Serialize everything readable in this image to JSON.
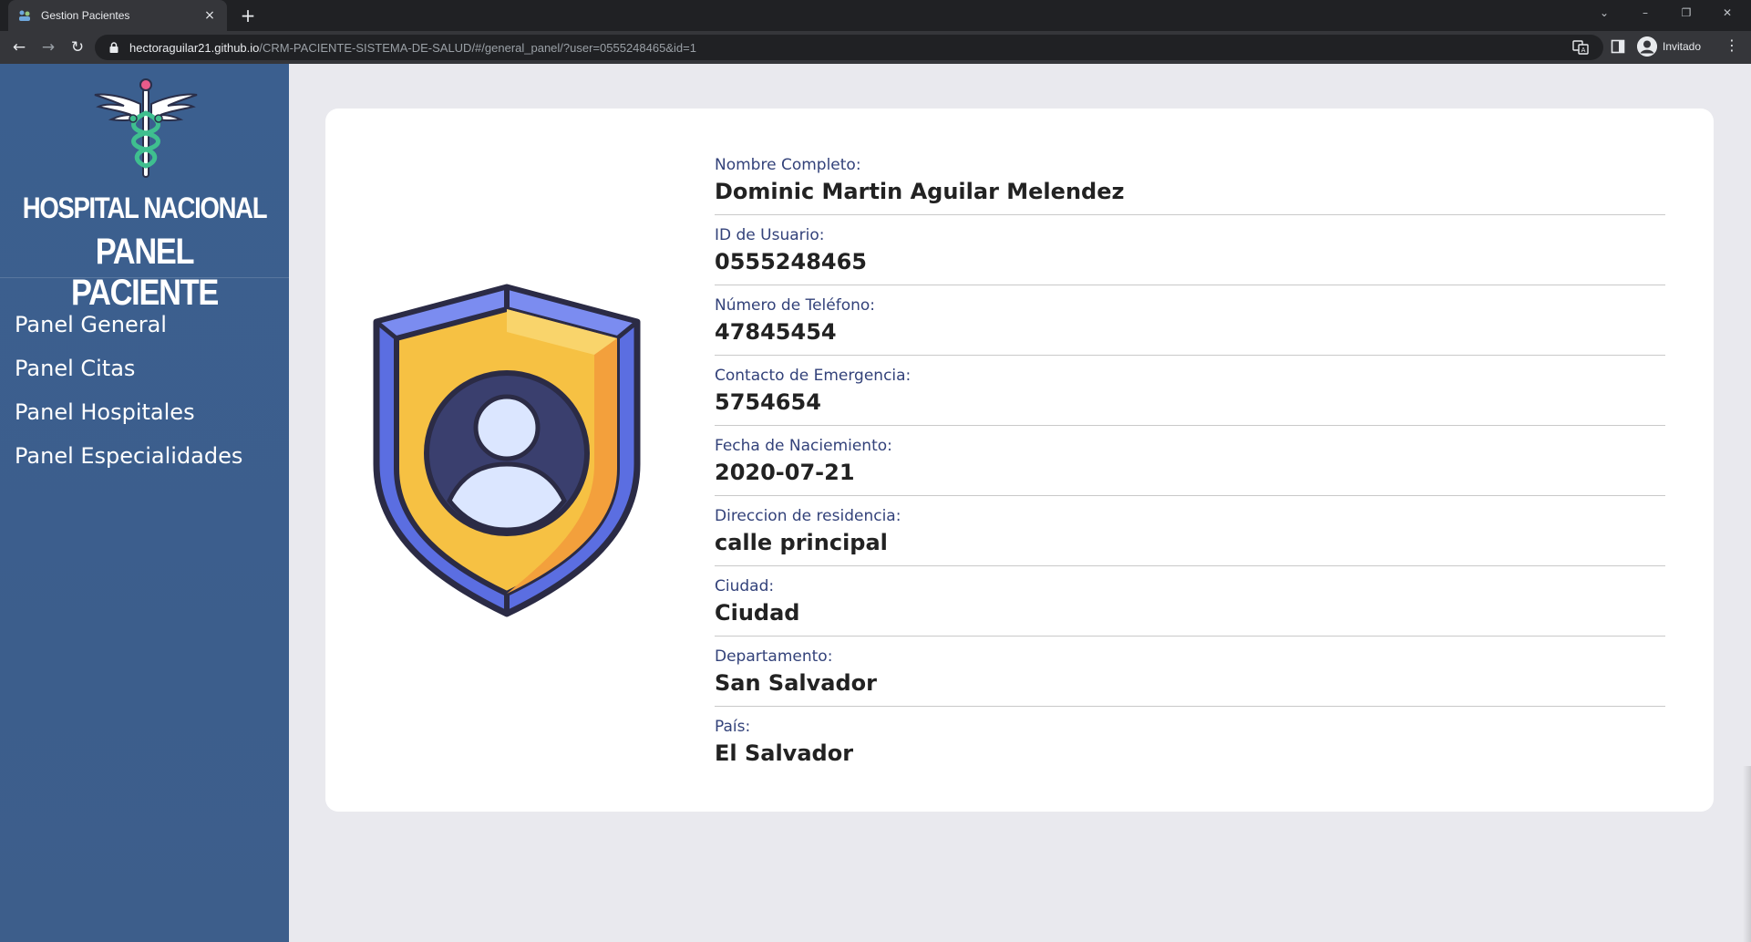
{
  "browser": {
    "tab_title": "Gestion Pacientes",
    "tab_close": "×",
    "new_tab": "+",
    "url_host": "hectoraguilar21.github.io",
    "url_path": "/CRM-PACIENTE-SISTEMA-DE-SALUD/#/general_panel/?user=0555248465&id=1",
    "profile_label": "Invitado",
    "icons": [
      "back-icon",
      "forward-icon",
      "reload-icon",
      "lock-icon",
      "translate-icon",
      "side-panel-icon",
      "profile-icon",
      "menu-icon"
    ]
  },
  "sidebar": {
    "brand_line1": "HOSPITAL NACIONAL",
    "brand_line2": "PANEL PACIENTE",
    "items": [
      {
        "label": "Panel General"
      },
      {
        "label": "Panel Citas"
      },
      {
        "label": "Panel Hospitales"
      },
      {
        "label": "Panel Especialidades"
      }
    ]
  },
  "patient": {
    "fields": [
      {
        "label": "Nombre Completo:",
        "value": "Dominic Martin Aguilar Melendez"
      },
      {
        "label": "ID de Usuario:",
        "value": "0555248465"
      },
      {
        "label": "Número de Teléfono:",
        "value": "47845454"
      },
      {
        "label": "Contacto de Emergencia:",
        "value": "5754654"
      },
      {
        "label": "Fecha de Naciemiento:",
        "value": "2020-07-21"
      },
      {
        "label": "Direccion de residencia:",
        "value": "calle principal"
      },
      {
        "label": "Ciudad:",
        "value": "Ciudad"
      },
      {
        "label": "Departamento:",
        "value": "San Salvador"
      },
      {
        "label": "País:",
        "value": "El Salvador"
      }
    ]
  },
  "colors": {
    "sidebar": "#3b5f8f",
    "label": "#33427a",
    "shield_outer": "#5b6ee1",
    "shield_inner": "#f6c143",
    "shield_center": "#3a3f6e"
  }
}
